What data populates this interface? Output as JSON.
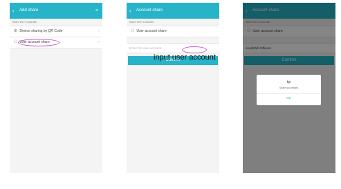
{
  "screen1": {
    "title": "Add share",
    "section": "Share Wi-Fi Controller",
    "items": [
      {
        "icon": "qr-icon",
        "label": "Device sharing by QR Code"
      },
      {
        "icon": "user-icon",
        "label": "User account share"
      }
    ]
  },
  "screen2": {
    "title": "Account share",
    "section": "Share Wi-Fi Controller",
    "row_label": "User account share",
    "input_placeholder": "Enter the user account",
    "confirm_label": "Confirm"
  },
  "annotation": "input user account",
  "screen3": {
    "title": "Account share",
    "section": "Share Wi-Fi Controller",
    "row_label": "User account share",
    "input_value": "cnn@Wifi Officare",
    "confirm_label": "Confirm",
    "dialog": {
      "title": "tip",
      "message": "Share successful",
      "ok_label": "OK"
    }
  },
  "colors": {
    "accent": "#27b4c8",
    "highlight": "#c64fc6"
  }
}
